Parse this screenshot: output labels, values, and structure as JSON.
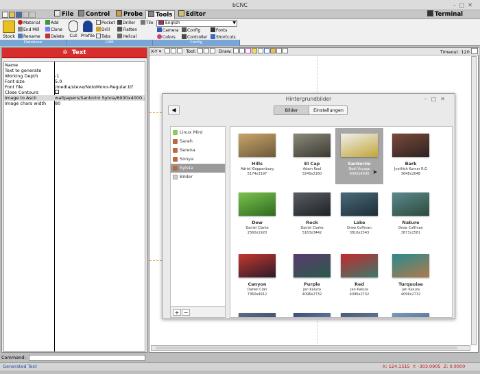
{
  "window": {
    "title": "bCNC",
    "controls": [
      "–",
      "□",
      "✕"
    ]
  },
  "menu_tabs": [
    {
      "label": "File",
      "active": false
    },
    {
      "label": "Control",
      "active": false
    },
    {
      "label": "Probe",
      "active": false
    },
    {
      "label": "Tools",
      "active": true
    },
    {
      "label": "Editor",
      "active": false
    },
    {
      "label": "Terminal",
      "active": false
    }
  ],
  "ribbon": {
    "stock": "Stock",
    "material": "Material",
    "end_mill": "End Mill",
    "rename": "Rename",
    "add": "Add",
    "clone": "Clone",
    "delete": "Delete",
    "cut": "Cut",
    "profile": "Profile",
    "pocket": "Pocket",
    "drill": "Drill",
    "tabs": "Tabs",
    "driller": "Driller",
    "flatten": "Flatten",
    "helical": "Helical",
    "tile": "Tile",
    "language": "English",
    "camera": "Camera",
    "config": "Config",
    "fonts": "Fonts",
    "colors": "Colors",
    "controller": "Controller",
    "shortcuts": "Shortcuts",
    "groups": [
      "Database",
      "CAM",
      "Config"
    ]
  },
  "left_panel": {
    "header": "Text",
    "rows": [
      {
        "key": "Name",
        "value": ""
      },
      {
        "key": "Text to generate",
        "value": ""
      },
      {
        "key": "Working Depth",
        "value": "-1"
      },
      {
        "key": "Font size",
        "value": "5.0"
      },
      {
        "key": "Font file",
        "value": "/media/steve/NotoMono-Regular.ttf"
      },
      {
        "key": "Close Contours",
        "value": ""
      },
      {
        "key": "Image to Ascii",
        "value": "wallpapers/Santorini Sylvia/6000x4000..."
      },
      {
        "key": "Image chars width",
        "value": "80"
      }
    ]
  },
  "canvas_toolbar": {
    "xy": "X-Y",
    "tool": "Tool:",
    "draw": "Draw:",
    "timeout_label": "Timeout:",
    "timeout_value": "120"
  },
  "command": {
    "label": "Command:",
    "value": ""
  },
  "status": {
    "message": "Generated Text",
    "x": "X: 124.1515",
    "y": "Y: -303.0905",
    "z": "Z: 0.0000"
  },
  "dialog": {
    "title": "Hintergrundbilder",
    "tabs": [
      "Bilder",
      "Einstellungen"
    ],
    "albums": [
      "Linux Mint",
      "Sarah",
      "Serena",
      "Sonya",
      "Sylvia",
      "Bilder"
    ],
    "selected_album": "Sylvia",
    "wallpapers": [
      {
        "name": "Hills",
        "author": "Adriel Kloppenburg",
        "size": "5174x3197",
        "colors": [
          "#c9a46a",
          "#6b5a3a"
        ]
      },
      {
        "name": "El Cap",
        "author": "Adam Kool",
        "size": "3240x2160",
        "colors": [
          "#8a8a7a",
          "#3e3a32"
        ]
      },
      {
        "name": "Santorini",
        "author": "Nodi Voyage",
        "size": "6000x4000",
        "colors": [
          "#efefef",
          "#c2a637"
        ]
      },
      {
        "name": "Bark",
        "author": "Jyothish Kumar R.G",
        "size": "3648x2048",
        "colors": [
          "#7a4a3c",
          "#2e2220"
        ]
      },
      {
        "name": "Dew",
        "author": "Daniel Clarke",
        "size": "2560x1920",
        "colors": [
          "#7ac24e",
          "#2f6a20"
        ]
      },
      {
        "name": "Rock",
        "author": "Daniel Clarke",
        "size": "5163x3442",
        "colors": [
          "#5a5e62",
          "#1e2226"
        ]
      },
      {
        "name": "Lake",
        "author": "Drew Coffman",
        "size": "3816x2543",
        "colors": [
          "#4a6a7a",
          "#1e2e36"
        ]
      },
      {
        "name": "Nature",
        "author": "Drew Coffman",
        "size": "3873x2581",
        "colors": [
          "#5a8a8e",
          "#2e4a3a"
        ]
      },
      {
        "name": "Canyon",
        "author": "Daniel Clah",
        "size": "7360x4912",
        "colors": [
          "#c2382e",
          "#2e1a2a"
        ]
      },
      {
        "name": "Purple",
        "author": "Jan Kaluza",
        "size": "4096x2732",
        "colors": [
          "#5a3a6e",
          "#2a5a4a"
        ]
      },
      {
        "name": "Red",
        "author": "Jan Kaluza",
        "size": "4096x2732",
        "colors": [
          "#c22a2e",
          "#3a7a6a"
        ]
      },
      {
        "name": "Turquoise",
        "author": "Jan Kaluza",
        "size": "4096x2732",
        "colors": [
          "#2a8a8e",
          "#b07a4a"
        ]
      },
      {
        "name": "",
        "author": "",
        "size": "",
        "colors": [
          "#5a6a8a",
          "#2a3a5a"
        ]
      },
      {
        "name": "",
        "author": "",
        "size": "",
        "colors": [
          "#3a4e7a",
          "#8a9aba"
        ]
      },
      {
        "name": "",
        "author": "",
        "size": "",
        "colors": [
          "#4a5a7a",
          "#7a8aa8"
        ]
      },
      {
        "name": "",
        "author": "",
        "size": "",
        "colors": [
          "#7a9aba",
          "#3a5a8a"
        ]
      }
    ],
    "selected_wallpaper": "Santorini"
  },
  "colors": {
    "header_red": "#d82d2d",
    "status_red": "#c01818",
    "status_blue": "#1c4fae",
    "ribbon_group_blue": "#7aa6d6"
  }
}
